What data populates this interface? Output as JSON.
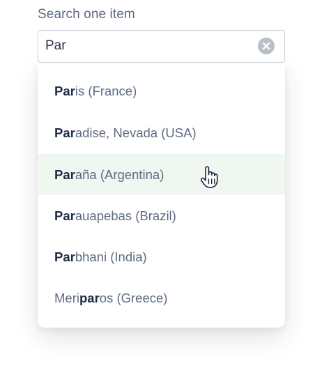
{
  "search": {
    "label": "Search one item",
    "value": "Par",
    "clear_icon": "x-circle-icon"
  },
  "options": [
    {
      "pre": "",
      "match": "Par",
      "post": "is (France)"
    },
    {
      "pre": "",
      "match": "Par",
      "post": "adise, Nevada (USA)"
    },
    {
      "pre": "",
      "match": "Par",
      "post": "aña (Argentina)"
    },
    {
      "pre": "",
      "match": "Par",
      "post": "auapebas (Brazil)"
    },
    {
      "pre": "",
      "match": "Par",
      "post": "bhani (India)"
    },
    {
      "pre": "Meri",
      "match": "par",
      "post": "os (Greece)"
    }
  ],
  "hovered_option_index": 2,
  "colors": {
    "hover_background": "#f0f7f1",
    "match_text": "#202b45",
    "option_text": "#5f6b82",
    "border": "#c9ced6"
  },
  "cursor_icon": "pointer-hand-icon"
}
